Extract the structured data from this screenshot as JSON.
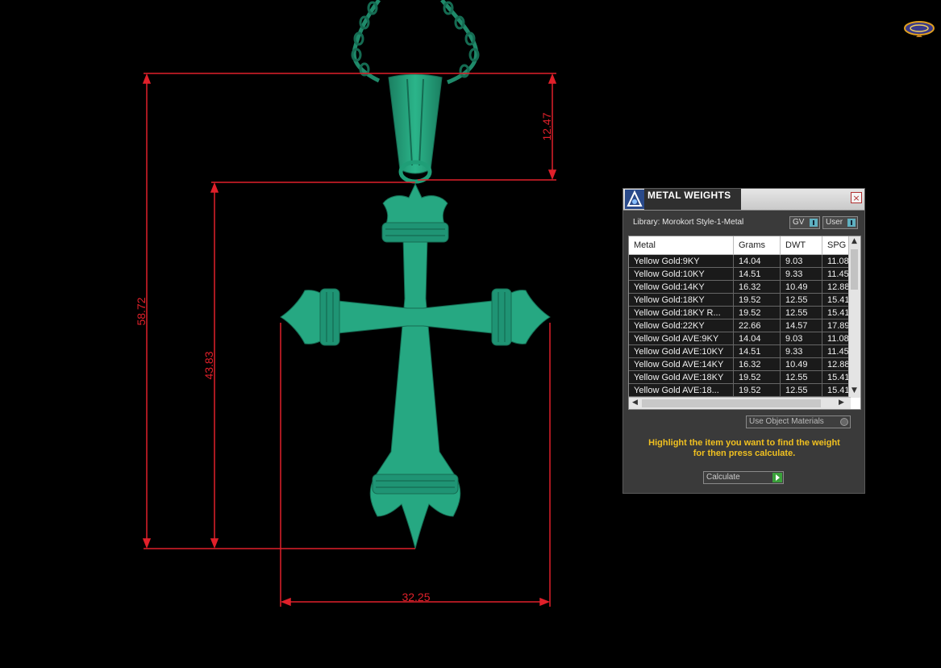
{
  "viewport": {
    "dimensions": [
      "12.47",
      "58.72",
      "43.83",
      "32.25"
    ],
    "accent_color": "#e0202a",
    "model_color": "#1f9e77"
  },
  "panel": {
    "title": "METAL WEIGHTS",
    "close_icon": "×",
    "library_label": "Library: Morokort Style-1-Metal",
    "toggle_gv": "GV",
    "toggle_user": "User",
    "columns": [
      "Metal",
      "Grams",
      "DWT",
      "SPG"
    ],
    "rows": [
      [
        "Yellow Gold:9KY",
        "14.04",
        "9.03",
        "11.08"
      ],
      [
        "Yellow Gold:10KY",
        "14.51",
        "9.33",
        "11.45"
      ],
      [
        "Yellow Gold:14KY",
        "16.32",
        "10.49",
        "12.88"
      ],
      [
        "Yellow Gold:18KY",
        "19.52",
        "12.55",
        "15.41"
      ],
      [
        "Yellow Gold:18KY R...",
        "19.52",
        "12.55",
        "15.41"
      ],
      [
        "Yellow Gold:22KY",
        "22.66",
        "14.57",
        "17.89"
      ],
      [
        "Yellow Gold AVE:9KY",
        "14.04",
        "9.03",
        "11.08"
      ],
      [
        "Yellow Gold AVE:10KY",
        "14.51",
        "9.33",
        "11.45"
      ],
      [
        "Yellow Gold AVE:14KY",
        "16.32",
        "10.49",
        "12.88"
      ],
      [
        "Yellow Gold AVE:18KY",
        "19.52",
        "12.55",
        "15.41"
      ],
      [
        "Yellow Gold AVE:18...",
        "19.52",
        "12.55",
        "15.41"
      ]
    ],
    "use_object_materials": "Use Object Materials",
    "hint_line1": "Highlight the item you want to find the weight",
    "hint_line2": "for then press calculate.",
    "calculate_label": "Calculate",
    "hint_color": "#f0c020"
  }
}
